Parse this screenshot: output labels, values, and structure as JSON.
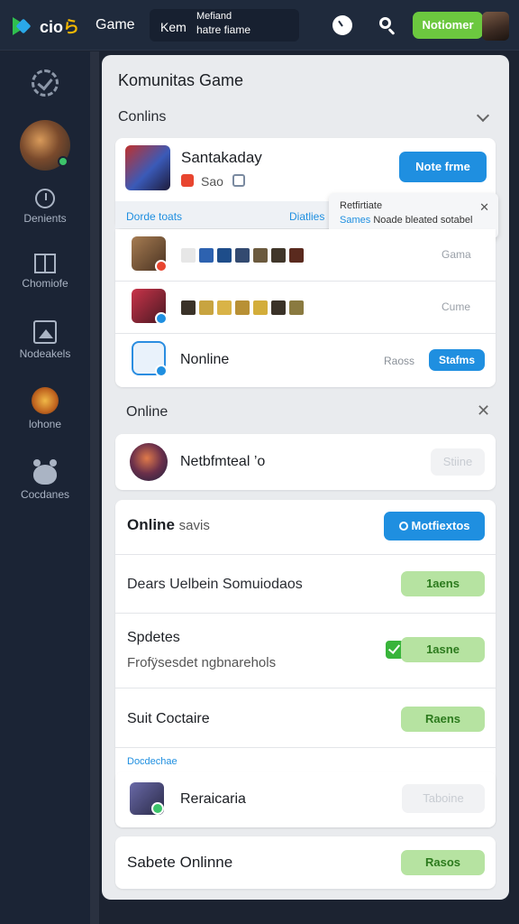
{
  "header": {
    "logo_text": "cio",
    "logo_accent": "ら",
    "nav_game": "Game",
    "search_prefix": "Kem",
    "search_line1": "Mefiand",
    "search_line2": "hatre fiame",
    "notify_label": "Notiomer"
  },
  "sidebar": {
    "items": [
      {
        "label": ""
      },
      {
        "label": ""
      },
      {
        "label": "Denients"
      },
      {
        "label": "Chomiofe"
      },
      {
        "label": "Nodeakels"
      },
      {
        "label": "lohone"
      },
      {
        "label": "Cocdanes"
      }
    ]
  },
  "panel": {
    "title": "Komunitas Game",
    "section1": "Conlins",
    "featured": {
      "name": "Santakaday",
      "sub": "Sao",
      "button": "Note frme",
      "link_left": "Dorde toats",
      "link_right": "Diatlies"
    },
    "tooltip": {
      "line1": "Retfirtiate",
      "line2_blue": "Sames",
      "line2_rest": "Noade bleated sotabel"
    },
    "list": [
      {
        "status": "Gama",
        "kind": "icons"
      },
      {
        "status": "Cume",
        "kind": "icons"
      },
      {
        "name": "Nonline",
        "meta": "Raoss",
        "button": "Stafms"
      }
    ],
    "section2": "Online",
    "card2": {
      "name": "Netbfmteal ’o",
      "button": "Stiine"
    },
    "online_card": {
      "title_bold": "Online",
      "title_rest": "savis",
      "button": "Motfiextos",
      "rows": [
        {
          "text": "Dears Uelbein Somuiodaos",
          "button": "1aens"
        },
        {
          "title": "Spdetes",
          "sub": "Frofÿsesdet ngbnarehols",
          "button": "1asne"
        },
        {
          "text": "Suit Coctaire",
          "button": "Raens"
        }
      ],
      "link": "Docdechae"
    },
    "card_rec": {
      "name": "Reraicaria",
      "button": "Taboine"
    },
    "bottom": {
      "name": "Sabete Onlinne",
      "button": "Rasos"
    }
  },
  "colors": {
    "accent_blue": "#1f8fe0",
    "accent_green": "#6cc83f",
    "sidebar_bg": "#1b2435",
    "panel_bg": "#e9ebee"
  }
}
